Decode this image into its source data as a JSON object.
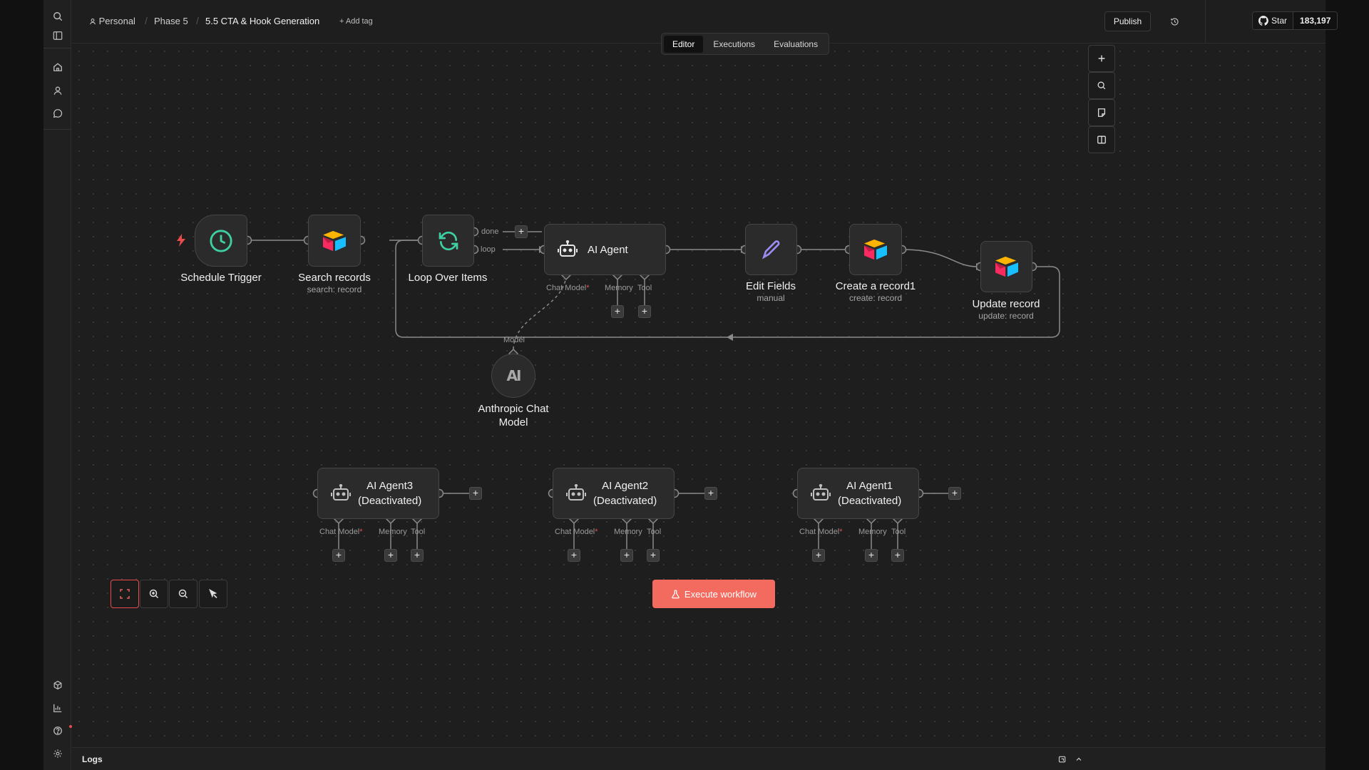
{
  "breadcrumb": {
    "project": "Personal",
    "folder": "Phase 5",
    "workflow": "5.5 CTA & Hook Generation",
    "add_tag": "+ Add tag"
  },
  "header": {
    "publish": "Publish",
    "github_star": "Star",
    "github_count": "183,197"
  },
  "tabs": [
    {
      "label": "Editor",
      "active": true
    },
    {
      "label": "Executions",
      "active": false
    },
    {
      "label": "Evaluations",
      "active": false
    }
  ],
  "nodes": {
    "schedule_trigger": {
      "label": "Schedule Trigger"
    },
    "search_records": {
      "label": "Search records",
      "sub": "search: record"
    },
    "loop_over_items": {
      "label": "Loop Over Items",
      "out_done": "done",
      "out_loop": "loop"
    },
    "ai_agent": {
      "label": "AI Agent",
      "chat_model": "Chat Model",
      "memory": "Memory",
      "tool": "Tool"
    },
    "edit_fields": {
      "label": "Edit Fields",
      "sub": "manual"
    },
    "create_record": {
      "label": "Create a record1",
      "sub": "create: record"
    },
    "update_record": {
      "label": "Update record",
      "sub": "update: record"
    },
    "anthropic": {
      "label_line1": "Anthropic Chat",
      "label_line2": "Model",
      "logo": "AI",
      "in_label": "Model"
    },
    "ai_agent3": {
      "line1": "AI Agent3",
      "line2": "(Deactivated)",
      "chat_model": "Chat Model",
      "memory": "Memory",
      "tool": "Tool"
    },
    "ai_agent2": {
      "line1": "AI Agent2",
      "line2": "(Deactivated)",
      "chat_model": "Chat Model",
      "memory": "Memory",
      "tool": "Tool"
    },
    "ai_agent1": {
      "line1": "AI Agent1",
      "line2": "(Deactivated)",
      "chat_model": "Chat Model",
      "memory": "Memory",
      "tool": "Tool"
    }
  },
  "required_mark": "*",
  "plus": "+",
  "execute": "Execute workflow",
  "logs": "Logs",
  "colors": {
    "accent": "#ea4b4b",
    "execute": "#f36a5f",
    "trigger_icon": "#3ecfa3",
    "loop_icon": "#3ecfa3",
    "edit_icon": "#9b8cf2"
  }
}
